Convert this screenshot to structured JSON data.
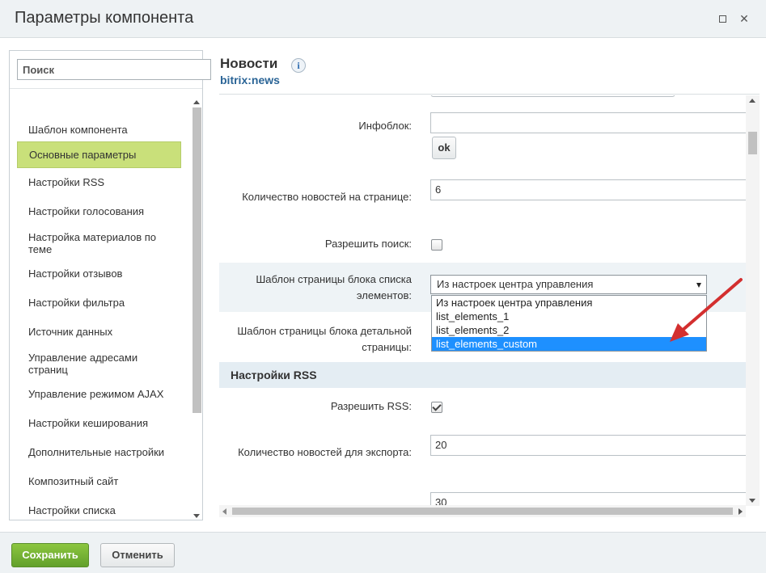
{
  "window": {
    "title": "Параметры компонента",
    "maximize_icon": "maximize-icon",
    "close_icon": "close-icon",
    "close_glyph": "✕"
  },
  "sidebar": {
    "search_placeholder": "Поиск",
    "items": [
      {
        "label": "Шаблон компонента"
      },
      {
        "label": "Основные параметры",
        "active": true
      },
      {
        "label": "Настройки RSS"
      },
      {
        "label": "Настройки голосования"
      },
      {
        "label": "Настройка материалов по теме"
      },
      {
        "label": "Настройки отзывов"
      },
      {
        "label": "Настройки фильтра"
      },
      {
        "label": "Источник данных"
      },
      {
        "label": "Управление адресами страниц"
      },
      {
        "label": "Управление режимом AJAX"
      },
      {
        "label": "Настройки кеширования"
      },
      {
        "label": "Дополнительные настройки"
      },
      {
        "label": "Композитный сайт"
      },
      {
        "label": "Настройки списка"
      }
    ]
  },
  "component": {
    "title": "Новости",
    "code": "bitrix:news",
    "info_glyph": "i"
  },
  "form": {
    "iblock_label": "Инфоблок:",
    "iblock_value": "",
    "ok_label": "ok",
    "news_count_label": "Количество новостей на странице:",
    "news_count_value": "6",
    "allow_search_label": "Разрешить поиск:",
    "allow_search_checked": false,
    "list_template_label": "Шаблон страницы блока списка элементов:",
    "list_template_value": "Из настроек центра управления",
    "list_template_options": [
      "Из настроек центра управления",
      "list_elements_1",
      "list_elements_2",
      "list_elements_custom"
    ],
    "list_template_highlighted": "list_elements_custom",
    "detail_template_label": "Шаблон страницы блока детальной страницы:",
    "rss_section_title": "Настройки RSS",
    "allow_rss_label": "Разрешить RSS:",
    "allow_rss_checked": true,
    "export_count_label": "Количество новостей для экспорта:",
    "export_count_value": "20",
    "next_field_value": "30"
  },
  "annotation": {
    "arrow_color": "#d32f2f"
  },
  "footer": {
    "save_label": "Сохранить",
    "cancel_label": "Отменить"
  },
  "colors": {
    "save_button": "#7cb342",
    "active_item": "#c9e07a",
    "highlight_option": "#1e90ff",
    "section_header": "#e4edf3"
  }
}
